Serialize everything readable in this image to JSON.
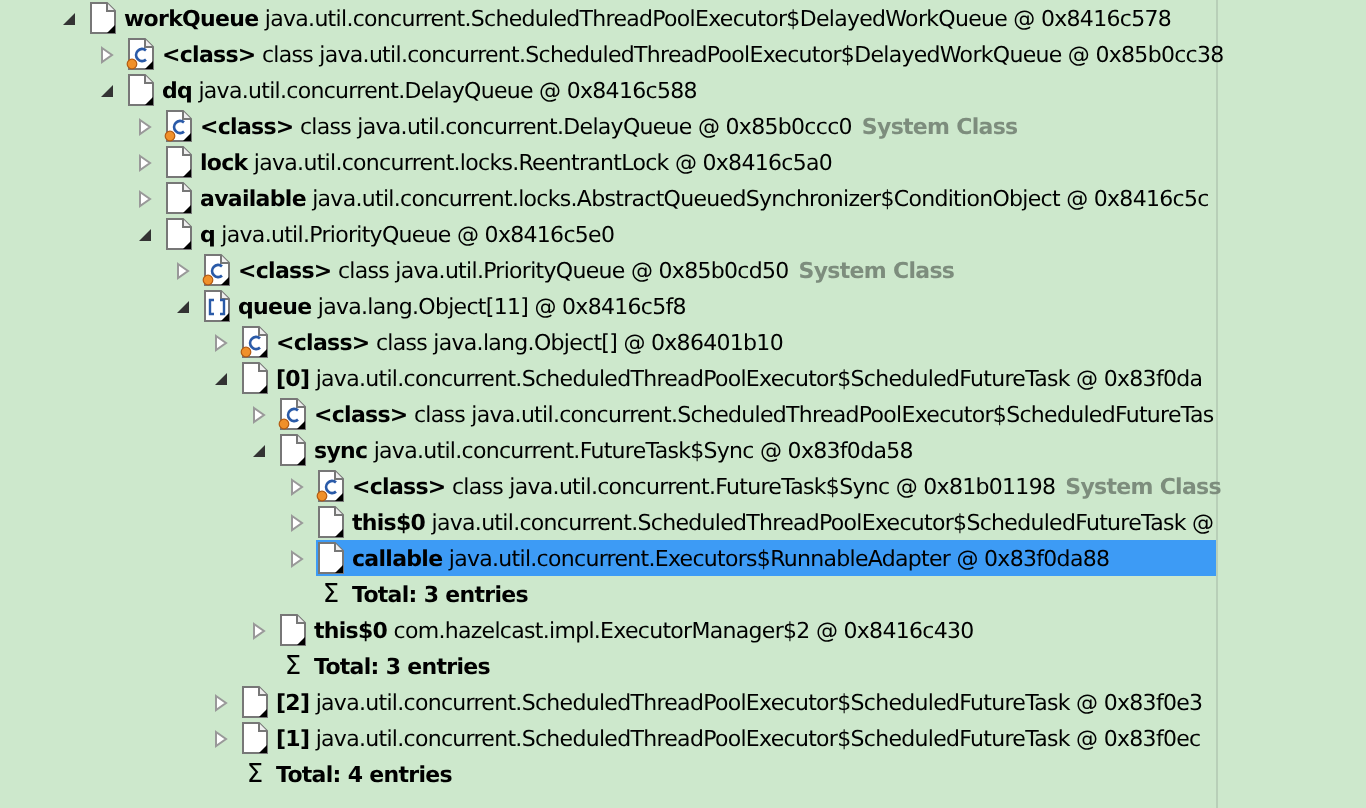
{
  "tree": [
    {
      "kind": "object",
      "label": "**workQueue** java.util.concurrent.ScheduledThreadPoolExecutor$DelayedWorkQueue @ 0x8416c578",
      "expanded": true,
      "selected": false,
      "children": [
        {
          "kind": "class",
          "label": "**<class>** class java.util.concurrent.ScheduledThreadPoolExecutor$DelayedWorkQueue @ 0x85b0cc38",
          "expanded": false,
          "selected": false
        },
        {
          "kind": "object",
          "label": "**dq** java.util.concurrent.DelayQueue @ 0x8416c588",
          "expanded": true,
          "selected": false,
          "children": [
            {
              "kind": "class",
              "label": "**<class>** class java.util.concurrent.DelayQueue @ 0x85b0ccc0",
              "note": "System Class",
              "expanded": false,
              "selected": false
            },
            {
              "kind": "object",
              "label": "**lock** java.util.concurrent.locks.ReentrantLock @ 0x8416c5a0",
              "expanded": false,
              "selected": false
            },
            {
              "kind": "object",
              "label": "**available** java.util.concurrent.locks.AbstractQueuedSynchronizer$ConditionObject @ 0x8416c5c",
              "expanded": false,
              "selected": false
            },
            {
              "kind": "object",
              "label": "**q** java.util.PriorityQueue @ 0x8416c5e0",
              "expanded": true,
              "selected": false,
              "children": [
                {
                  "kind": "class",
                  "label": "**<class>** class java.util.PriorityQueue @ 0x85b0cd50",
                  "note": "System Class",
                  "expanded": false,
                  "selected": false
                },
                {
                  "kind": "array",
                  "label": "**queue** java.lang.Object[11] @ 0x8416c5f8",
                  "expanded": true,
                  "selected": false,
                  "children": [
                    {
                      "kind": "class",
                      "label": "**<class>** class java.lang.Object[] @ 0x86401b10",
                      "expanded": false,
                      "selected": false
                    },
                    {
                      "kind": "object",
                      "label": "**[0]** java.util.concurrent.ScheduledThreadPoolExecutor$ScheduledFutureTask @ 0x83f0da",
                      "expanded": true,
                      "selected": false,
                      "children": [
                        {
                          "kind": "class",
                          "label": "**<class>** class java.util.concurrent.ScheduledThreadPoolExecutor$ScheduledFutureTas",
                          "expanded": false,
                          "selected": false
                        },
                        {
                          "kind": "object",
                          "label": "**sync** java.util.concurrent.FutureTask$Sync @ 0x83f0da58",
                          "expanded": true,
                          "selected": false,
                          "children": [
                            {
                              "kind": "class",
                              "label": "**<class>** class java.util.concurrent.FutureTask$Sync @ 0x81b01198",
                              "note": "System Class",
                              "expanded": false,
                              "selected": false
                            },
                            {
                              "kind": "object",
                              "label": "**this$0** java.util.concurrent.ScheduledThreadPoolExecutor$ScheduledFutureTask @",
                              "expanded": false,
                              "selected": false
                            },
                            {
                              "kind": "object",
                              "label": "**callable** java.util.concurrent.Executors$RunnableAdapter @ 0x83f0da88",
                              "expanded": false,
                              "selected": true
                            },
                            {
                              "kind": "total",
                              "icon": "Σ",
                              "label": "Total: 3 entries",
                              "selected": false
                            }
                          ]
                        },
                        {
                          "kind": "object",
                          "label": "**this$0** com.hazelcast.impl.ExecutorManager$2 @ 0x8416c430",
                          "expanded": false,
                          "selected": false
                        },
                        {
                          "kind": "total",
                          "icon": "Σ",
                          "label": "Total: 3 entries",
                          "selected": false
                        }
                      ]
                    },
                    {
                      "kind": "object",
                      "label": "**[2]** java.util.concurrent.ScheduledThreadPoolExecutor$ScheduledFutureTask @ 0x83f0e3",
                      "expanded": false,
                      "selected": false
                    },
                    {
                      "kind": "object",
                      "label": "**[1]** java.util.concurrent.ScheduledThreadPoolExecutor$ScheduledFutureTask @ 0x83f0ec",
                      "expanded": false,
                      "selected": false
                    },
                    {
                      "kind": "total",
                      "icon": "Σ",
                      "label": "Total: 4 entries",
                      "selected": false
                    }
                  ]
                }
              ]
            }
          ]
        }
      ]
    }
  ]
}
